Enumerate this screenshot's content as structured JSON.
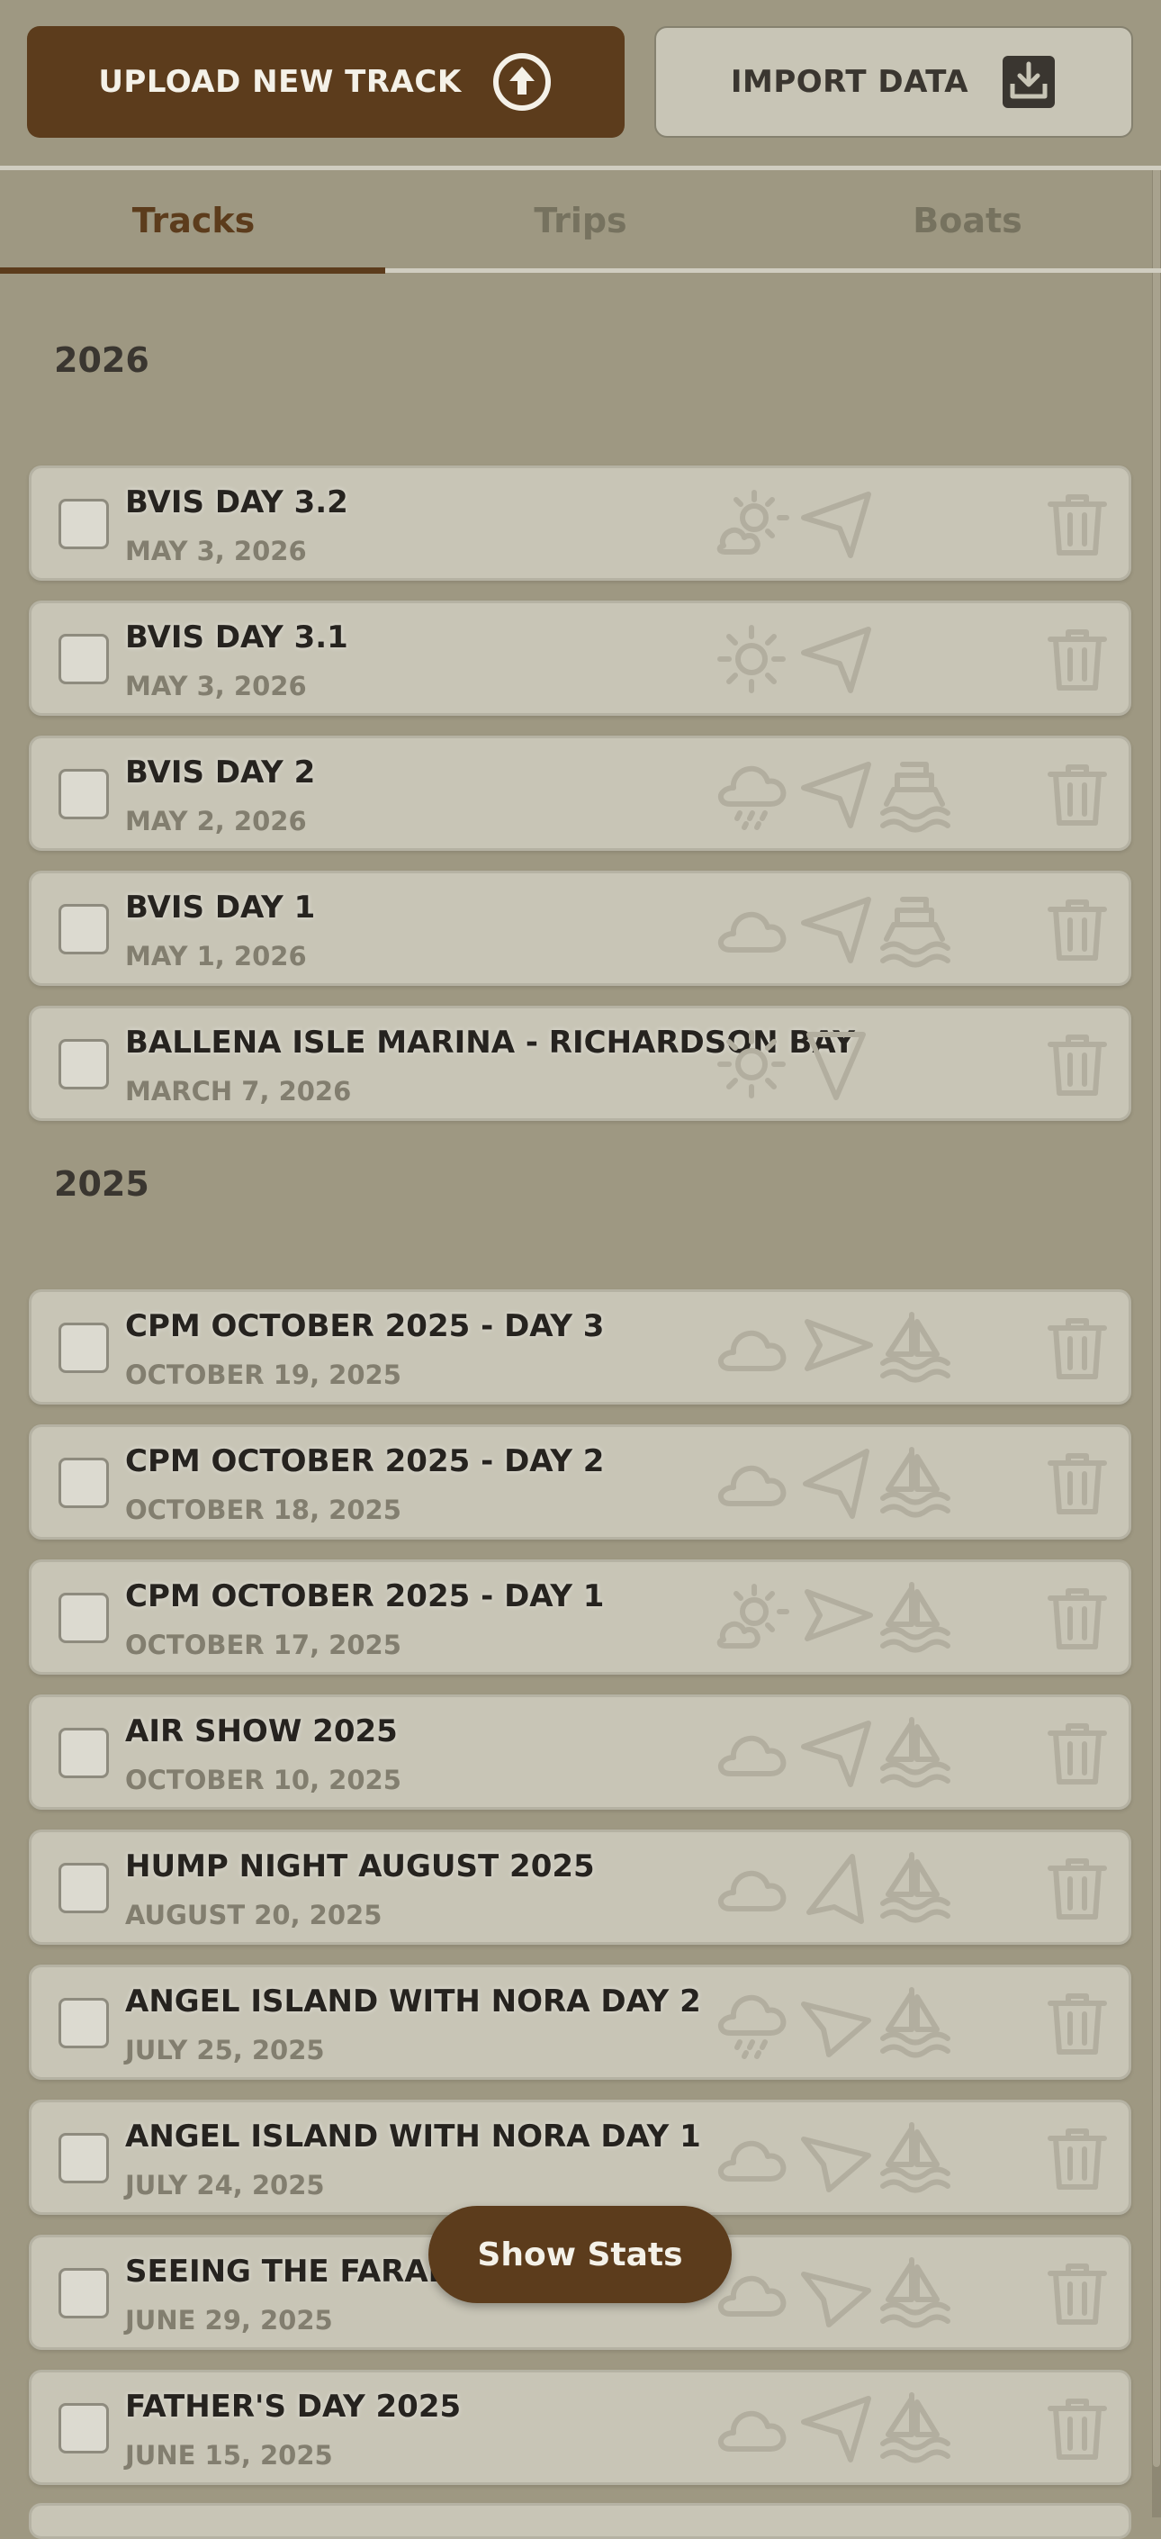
{
  "header": {
    "upload_label": "UPLOAD NEW TRACK",
    "import_label": "IMPORT DATA"
  },
  "tabs": [
    {
      "label": "Tracks",
      "active": true
    },
    {
      "label": "Trips",
      "active": false
    },
    {
      "label": "Boats",
      "active": false
    }
  ],
  "years": [
    "2026",
    "2025"
  ],
  "tracks_2026": [
    {
      "title": "BVIS DAY 3.2",
      "date": "MAY 3, 2026",
      "weather": "partly-sunny-icon",
      "direction": "upper-right",
      "boat": "none"
    },
    {
      "title": "BVIS DAY 3.1",
      "date": "MAY 3, 2026",
      "weather": "sun-icon",
      "direction": "upper-right",
      "boat": "none"
    },
    {
      "title": "BVIS DAY 2",
      "date": "MAY 2, 2026",
      "weather": "rain-cloud-icon",
      "direction": "upper-right",
      "boat": "ferry-icon"
    },
    {
      "title": "BVIS DAY 1",
      "date": "MAY 1, 2026",
      "weather": "cloud-icon",
      "direction": "upper-right",
      "boat": "ferry-icon"
    },
    {
      "title": "BALLENA ISLE MARINA - RICHARDSON BAY",
      "date": "MARCH 7, 2026",
      "weather": "sun-icon",
      "direction": "down",
      "boat": "none"
    }
  ],
  "tracks_2025": [
    {
      "title": "CPM OCTOBER 2025 - DAY 3",
      "date": "OCTOBER 19, 2025",
      "weather": "cloud-icon",
      "direction": "right",
      "boat": "sailboat-icon"
    },
    {
      "title": "CPM OCTOBER 2025 - DAY 2",
      "date": "OCTOBER 18, 2025",
      "weather": "cloud-icon",
      "direction": "up-right",
      "boat": "sailboat-icon"
    },
    {
      "title": "CPM OCTOBER 2025 - DAY 1",
      "date": "OCTOBER 17, 2025",
      "weather": "partly-sunny-icon",
      "direction": "right",
      "boat": "sailboat-icon"
    },
    {
      "title": "AIR SHOW 2025",
      "date": "OCTOBER 10, 2025",
      "weather": "cloud-icon",
      "direction": "upper-right",
      "boat": "sailboat-icon"
    },
    {
      "title": "HUMP NIGHT AUGUST 2025",
      "date": "AUGUST 20, 2025",
      "weather": "cloud-icon",
      "direction": "up",
      "boat": "sailboat-icon"
    },
    {
      "title": "ANGEL ISLAND WITH NORA DAY 2",
      "date": "JULY 25, 2025",
      "weather": "rain-cloud-icon",
      "direction": "lower-right",
      "boat": "sailboat-icon"
    },
    {
      "title": "ANGEL ISLAND WITH NORA DAY 1",
      "date": "JULY 24, 2025",
      "weather": "cloud-icon",
      "direction": "lower-right",
      "boat": "sailboat-icon"
    },
    {
      "title": "SEEING THE FARALL",
      "date": "JUNE 29, 2025",
      "weather": "cloud-icon",
      "direction": "lower-right",
      "boat": "sailboat-icon"
    },
    {
      "title": "FATHER'S DAY 2025",
      "date": "JUNE 15, 2025",
      "weather": "cloud-icon",
      "direction": "upper-right",
      "boat": "sailboat-icon"
    }
  ],
  "stats_button": "Show Stats",
  "colors": {
    "background": "#9e9882",
    "card": "#c8c5b6",
    "accent_brown": "#5c3c1c",
    "icon_faint": "#b2ae9f",
    "title_text": "#26231f"
  }
}
